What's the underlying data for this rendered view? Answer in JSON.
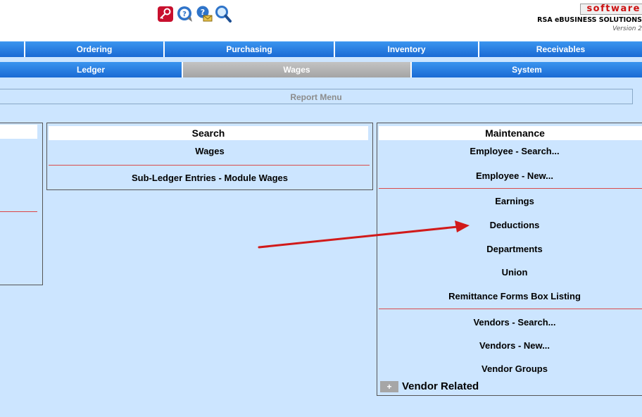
{
  "brand": {
    "wordmark": "software",
    "company": "RSA eBUSINESS SOLUTIONS",
    "version": "Version 2"
  },
  "toolbar_icons": [
    "key-icon",
    "help-icon",
    "help-mail-icon",
    "search-magnifier-icon"
  ],
  "nav_row1": [
    "Ordering",
    "Purchasing",
    "Inventory",
    "Receivables"
  ],
  "nav_row2": [
    "Ledger",
    "Wages",
    "System"
  ],
  "nav_active": "Wages",
  "report_menu": "Report Menu",
  "search_panel": {
    "title": "Search",
    "items": [
      "Wages",
      "Sub-Ledger Entries - Module Wages"
    ]
  },
  "maintenance_panel": {
    "title": "Maintenance",
    "items": [
      "Employee - Search...",
      "Employee - New...",
      "Earnings",
      "Deductions",
      "Departments",
      "Union",
      "Remittance Forms Box Listing",
      "Vendors - Search...",
      "Vendors - New...",
      "Vendor Groups"
    ],
    "expander_symbol": "+",
    "expander_label": "Vendor Related"
  },
  "colors": {
    "background": "#cce5ff",
    "nav_blue": "#1a6ad4",
    "nav_active_gray": "#a4a4a4",
    "separator_red": "#d94b4b",
    "annotation_arrow": "#d11a1a"
  }
}
